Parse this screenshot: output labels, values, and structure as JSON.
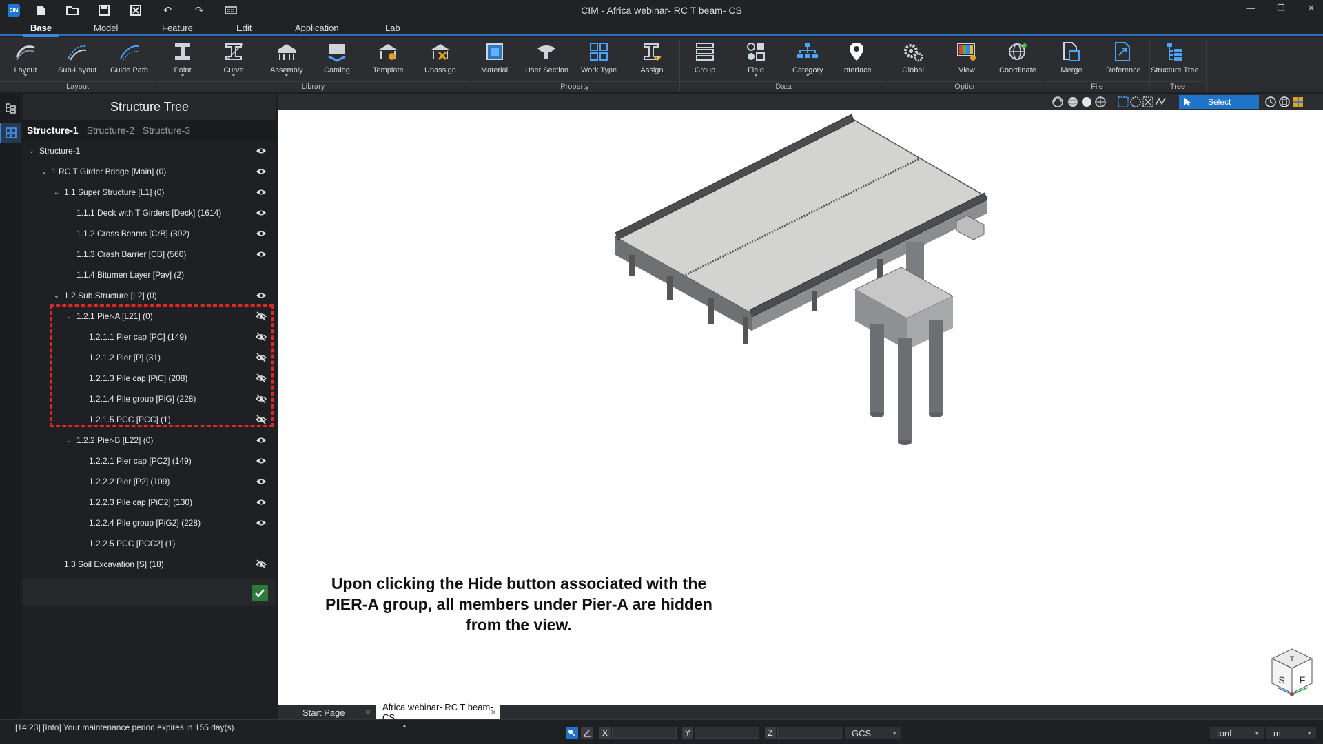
{
  "window": {
    "title": "CIM - Africa webinar- RC T beam- CS",
    "logo_text": "CIM"
  },
  "menu": {
    "tabs": [
      "Base",
      "Model",
      "Feature",
      "Edit",
      "Application",
      "Lab"
    ],
    "active": "Base"
  },
  "ribbon": {
    "groups": {
      "layout": "Layout",
      "library": "Library",
      "property": "Property",
      "data": "Data",
      "option": "Option",
      "file": "File",
      "tree": "Tree"
    },
    "buttons": {
      "layout": "Layout",
      "sub_layout": "Sub-Layout",
      "guide_path": "Guide Path",
      "point": "Point",
      "curve": "Curve",
      "assembly": "Assembly",
      "catalog": "Catalog",
      "template": "Template",
      "unassign": "Unassign",
      "material": "Material",
      "user_section": "User Section",
      "work_type": "Work Type",
      "assign": "Assign",
      "group": "Group",
      "field": "Field",
      "category": "Category",
      "interface": "Interface",
      "global": "Global",
      "view": "View",
      "coordinate": "Coordinate",
      "merge": "Merge",
      "reference": "Reference",
      "structure_tree": "Structure Tree"
    }
  },
  "tree_panel": {
    "title": "Structure Tree",
    "subtabs": [
      "Structure-1",
      "Structure-2",
      "Structure-3"
    ],
    "active_subtab": "Structure-1",
    "rows": [
      {
        "label": "Structure-1",
        "level": 0,
        "expand": true,
        "eye": "visible"
      },
      {
        "label": "1 RC T Girder Bridge [Main] (0)",
        "level": 1,
        "expand": true,
        "eye": "visible"
      },
      {
        "label": "1.1 Super Structure [L1] (0)",
        "level": 2,
        "expand": true,
        "eye": "visible"
      },
      {
        "label": "1.1.1 Deck with T Girders [Deck] (1614)",
        "level": 3,
        "expand": false,
        "eye": "visible"
      },
      {
        "label": "1.1.2 Cross Beams [CrB] (392)",
        "level": 3,
        "expand": false,
        "eye": "visible"
      },
      {
        "label": "1.1.3 Crash Barrier [CB] (560)",
        "level": 3,
        "expand": false,
        "eye": "visible"
      },
      {
        "label": "1.1.4 Bitumen Layer [Pav] (2)",
        "level": 3,
        "expand": false,
        "eye": "none"
      },
      {
        "label": "1.2 Sub Structure [L2] (0)",
        "level": 2,
        "expand": true,
        "eye": "visible"
      },
      {
        "label": "1.2.1 Pier-A [L21] (0)",
        "level": 3,
        "expand": true,
        "eye": "hidden"
      },
      {
        "label": "1.2.1.1 Pier cap [PC] (149)",
        "level": 4,
        "expand": false,
        "eye": "hidden"
      },
      {
        "label": "1.2.1.2 Pier  [P] (31)",
        "level": 4,
        "expand": false,
        "eye": "hidden"
      },
      {
        "label": "1.2.1.3 Pile cap [PiC] (208)",
        "level": 4,
        "expand": false,
        "eye": "hidden"
      },
      {
        "label": "1.2.1.4 Pile group [PiG] (228)",
        "level": 4,
        "expand": false,
        "eye": "hidden"
      },
      {
        "label": "1.2.1.5 PCC [PCC] (1)",
        "level": 4,
        "expand": false,
        "eye": "hidden"
      },
      {
        "label": "1.2.2 Pier-B [L22] (0)",
        "level": 3,
        "expand": true,
        "eye": "visible"
      },
      {
        "label": "1.2.2.1 Pier cap [PC2] (149)",
        "level": 4,
        "expand": false,
        "eye": "visible"
      },
      {
        "label": "1.2.2.2 Pier  [P2] (109)",
        "level": 4,
        "expand": false,
        "eye": "visible"
      },
      {
        "label": "1.2.2.3 Pile cap [PiC2] (130)",
        "level": 4,
        "expand": false,
        "eye": "visible"
      },
      {
        "label": "1.2.2.4 Pile group [PiG2] (228)",
        "level": 4,
        "expand": false,
        "eye": "visible"
      },
      {
        "label": "1.2.2.5 PCC [PCC2] (1)",
        "level": 4,
        "expand": false,
        "eye": "none"
      },
      {
        "label": "1.3 Soil Excavation [S] (18)",
        "level": 2,
        "expand": false,
        "eye": "hidden"
      }
    ]
  },
  "view_toolbar": {
    "select_label": "Select"
  },
  "viewport": {
    "annotation": "Upon clicking the Hide button associated with the PIER-A group, all members under Pier-A are hidden from the view.",
    "cube_faces": {
      "top": "T",
      "left": "S",
      "right": "F"
    }
  },
  "doc_tabs": {
    "tabs": [
      "Start Page",
      "Africa webinar- RC T beam- CS"
    ],
    "active": "Africa webinar- RC T beam- CS"
  },
  "status": {
    "message": "[14:23] [Info] Your maintenance period expires in 155 day(s).",
    "coord_labels": [
      "X",
      "Y",
      "Z"
    ],
    "coord_system": "GCS",
    "force_unit": "tonf",
    "length_unit": "m"
  },
  "colors": {
    "accent": "#3a86d8",
    "highlight_box": "#e02727",
    "viewport_bg": "#ffffff"
  }
}
